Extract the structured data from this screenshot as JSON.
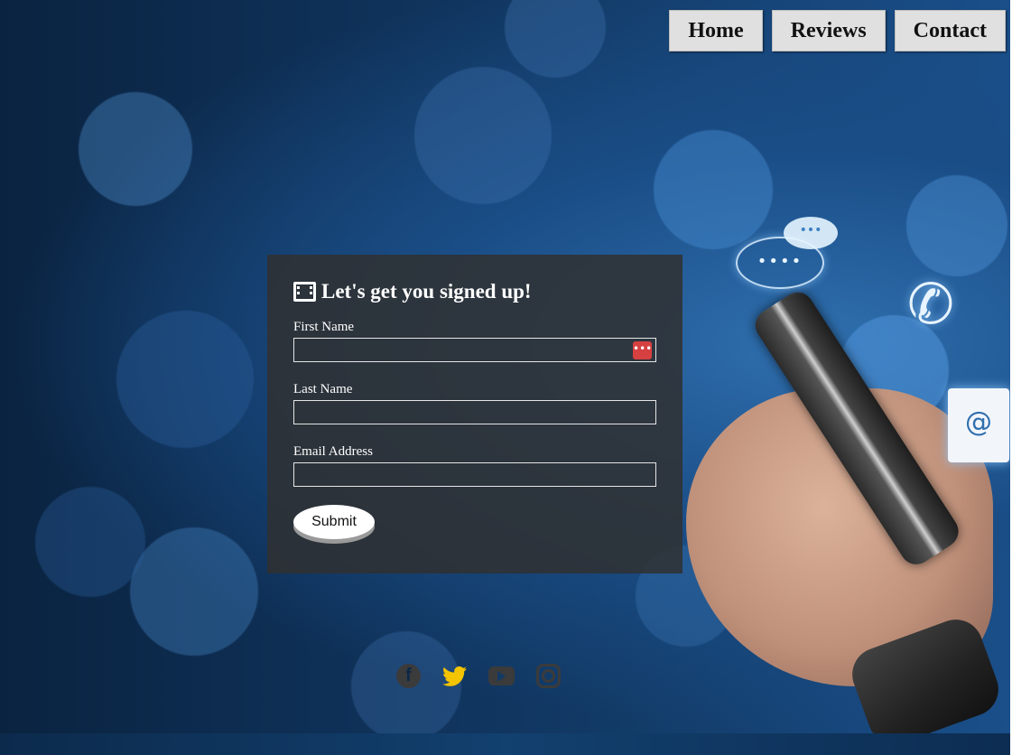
{
  "nav": {
    "items": [
      {
        "label": "Home"
      },
      {
        "label": "Reviews"
      },
      {
        "label": "Contact"
      }
    ]
  },
  "form": {
    "title": "Let's get you signed up!",
    "title_icon": "film-icon",
    "fields": [
      {
        "label": "First Name",
        "value": "",
        "placeholder": "",
        "has_password_manager_icon": true
      },
      {
        "label": "Last Name",
        "value": "",
        "placeholder": ""
      },
      {
        "label": "Email Address",
        "value": "",
        "placeholder": ""
      }
    ],
    "submit_label": "Submit"
  },
  "social": {
    "icons": [
      "facebook-icon",
      "twitter-icon",
      "youtube-icon",
      "instagram-icon"
    ],
    "twitter_color": "#f5c400",
    "muted_color": "#3b3b3b"
  },
  "decor": {
    "icons": [
      "chat-bubble-icon",
      "phone-call-icon",
      "email-icon"
    ]
  },
  "colors": {
    "panel_bg": "rgba(48,48,48,0.85)",
    "nav_bg": "#e0e0e0",
    "bg_dark": "#0a2340",
    "bg_light": "#1a4f8a"
  }
}
